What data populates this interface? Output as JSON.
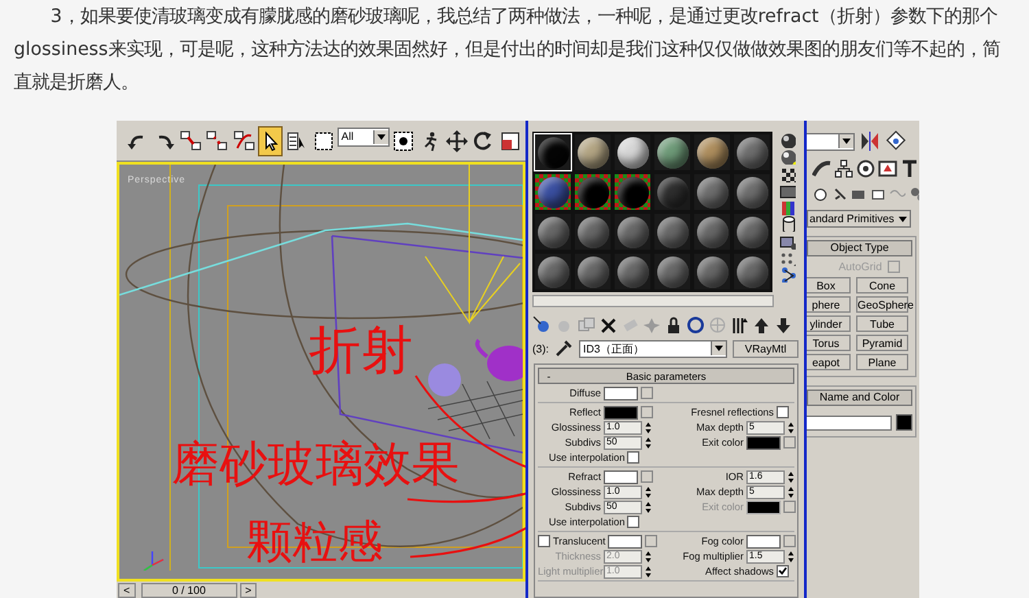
{
  "article": {
    "paragraph": "3，如果要使清玻璃变成有朦胧感的磨砂玻璃呢，我总结了两种做法，一种呢，是通过更改refract（折射）参数下的那个glossiness来实现，可是呢，这种方法达的效果固然好，但是付出的时间却是我们这种仅仅做做效果图的朋友们等不起的，简直就是折磨人。"
  },
  "screenshot": {
    "toolbar": {
      "tools": [
        {
          "kind": "undo",
          "selected": false
        },
        {
          "kind": "redo",
          "selected": false
        },
        {
          "kind": "link",
          "selected": false
        },
        {
          "kind": "unlink",
          "selected": false
        },
        {
          "kind": "bind",
          "selected": false
        },
        {
          "kind": "select",
          "selected": true
        },
        {
          "kind": "select_by_name",
          "selected": false
        },
        {
          "kind": "region",
          "selected": false
        },
        {
          "kind": "filter",
          "value": "All",
          "selected": false
        },
        {
          "kind": "target",
          "selected": false
        },
        {
          "kind": "manipulate",
          "selected": false
        },
        {
          "kind": "move",
          "selected": false
        },
        {
          "kind": "rotate",
          "selected": false
        },
        {
          "kind": "scale",
          "selected": false
        }
      ]
    },
    "viewport": {
      "label": "Perspective",
      "active": true
    },
    "time_slider": {
      "prev": "<",
      "frame": "0 / 100",
      "next": ">"
    },
    "annotations": [
      "折射",
      "磨砂玻璃效果",
      "颗粒感"
    ],
    "material_editor": {
      "slots": [
        {
          "kind": "plain",
          "color": "#050505",
          "selected": true
        },
        {
          "kind": "plain",
          "color": "#b3a584",
          "selected": false
        },
        {
          "kind": "plain",
          "color": "#d6d6d6",
          "selected": false
        },
        {
          "kind": "plain",
          "color": "#6e9a78",
          "selected": false
        },
        {
          "kind": "plain",
          "color": "#ae8e5e",
          "selected": false
        },
        {
          "kind": "plain",
          "color": "#6e6e6e",
          "selected": false
        },
        {
          "kind": "checker",
          "color": "#3a4fa0",
          "selected": false
        },
        {
          "kind": "checker",
          "color": "#000000",
          "selected": false
        },
        {
          "kind": "checker",
          "color": "#000000",
          "selected": false
        },
        {
          "kind": "plain",
          "color": "#2e2e2e",
          "selected": false
        },
        {
          "kind": "plain",
          "color": "#6e6e6e",
          "selected": false
        },
        {
          "kind": "plain",
          "color": "#6e6e6e",
          "selected": false
        },
        {
          "kind": "plain",
          "color": "#686868",
          "selected": false
        },
        {
          "kind": "plain",
          "color": "#686868",
          "selected": false
        },
        {
          "kind": "plain",
          "color": "#686868",
          "selected": false
        },
        {
          "kind": "plain",
          "color": "#686868",
          "selected": false
        },
        {
          "kind": "plain",
          "color": "#686868",
          "selected": false
        },
        {
          "kind": "plain",
          "color": "#686868",
          "selected": false
        },
        {
          "kind": "plain",
          "color": "#686868",
          "selected": false
        },
        {
          "kind": "plain",
          "color": "#686868",
          "selected": false
        },
        {
          "kind": "plain",
          "color": "#686868",
          "selected": false
        },
        {
          "kind": "plain",
          "color": "#686868",
          "selected": false
        },
        {
          "kind": "plain",
          "color": "#686868",
          "selected": false
        },
        {
          "kind": "plain",
          "color": "#686868",
          "selected": false
        }
      ],
      "slot_label": "(3):",
      "material_name": "ID3（正面）",
      "material_type": "VRayMtl",
      "rollout_sign": "-",
      "rollout_title": "Basic parameters",
      "param_groups": [
        [
          {
            "left": {
              "kind": "swatch",
              "label": "Diffuse",
              "color": "#ffffff",
              "disabled": false
            }
          }
        ],
        [
          {
            "left": {
              "kind": "swatch",
              "label": "Reflect",
              "color": "#000000",
              "disabled": false
            },
            "right": {
              "kind": "check",
              "label": "Fresnel reflections",
              "checked": false,
              "disabled": false
            }
          },
          {
            "left": {
              "kind": "spinner",
              "label": "Glossiness",
              "value": "1.0",
              "disabled": false
            },
            "right": {
              "kind": "spinner",
              "label": "Max depth",
              "value": "5",
              "disabled": false
            }
          },
          {
            "left": {
              "kind": "spinner",
              "label": "Subdivs",
              "value": "50",
              "disabled": false
            },
            "right": {
              "kind": "swatch",
              "label": "Exit color",
              "color": "#000000",
              "disabled": false
            }
          },
          {
            "left": {
              "kind": "check",
              "label": "Use interpolation",
              "checked": false,
              "disabled": false
            }
          }
        ],
        [
          {
            "left": {
              "kind": "swatch",
              "label": "Refract",
              "color": "#ffffff",
              "disabled": false
            },
            "right": {
              "kind": "spinner",
              "label": "IOR",
              "value": "1.6",
              "disabled": false
            }
          },
          {
            "left": {
              "kind": "spinner",
              "label": "Glossiness",
              "value": "1.0",
              "disabled": false
            },
            "right": {
              "kind": "spinner",
              "label": "Max depth",
              "value": "5",
              "disabled": false
            }
          },
          {
            "left": {
              "kind": "spinner",
              "label": "Subdivs",
              "value": "50",
              "disabled": false
            },
            "right": {
              "kind": "swatch",
              "label": "Exit color",
              "color": "#000000",
              "disabled": true
            }
          },
          {
            "left": {
              "kind": "check",
              "label": "Use interpolation",
              "checked": false,
              "disabled": false
            }
          }
        ],
        [
          {
            "left": {
              "kind": "check-swatch",
              "label": "Translucent",
              "checked": false,
              "color": "#ffffff",
              "disabled": false
            },
            "right": {
              "kind": "swatch",
              "label": "Fog color",
              "color": "#ffffff",
              "disabled": false
            }
          },
          {
            "left": {
              "kind": "spinner",
              "label": "Thickness",
              "value": "2.0",
              "disabled": true
            },
            "right": {
              "kind": "spinner",
              "label": "Fog multiplier",
              "value": "1.5",
              "disabled": false
            }
          },
          {
            "left": {
              "kind": "spinner",
              "label": "Light multiplier",
              "value": "1.0",
              "disabled": true
            },
            "right": {
              "kind": "check",
              "label": "Affect shadows",
              "checked": true,
              "disabled": false
            }
          }
        ]
      ]
    },
    "command_panel": {
      "category": "andard Primitives",
      "object_type_title": "Object Type",
      "autogrid": {
        "label": "AutoGrid",
        "checked": false,
        "disabled": true
      },
      "buttons": [
        "Box",
        "Cone",
        "phere",
        "GeoSphere",
        "ylinder",
        "Tube",
        "Torus",
        "Pyramid",
        "eapot",
        "Plane"
      ],
      "name_color_title": "Name and Color",
      "object_swatch": {
        "color": "#000000"
      }
    }
  }
}
